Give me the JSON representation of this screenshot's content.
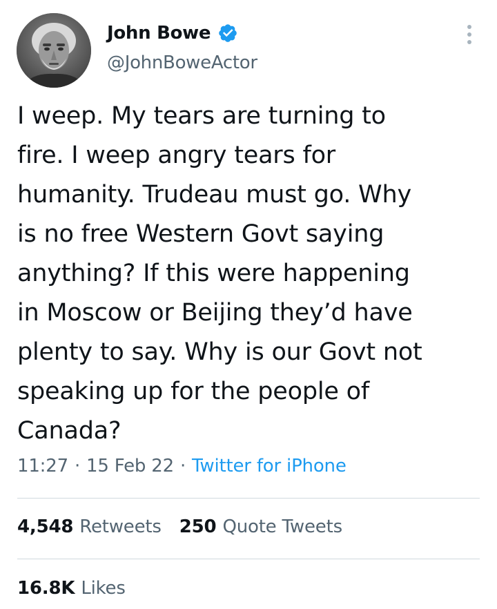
{
  "author": {
    "display_name": "John Bowe",
    "handle": "@JohnBoweActor",
    "avatar_icon": "portrait-photo",
    "verified_icon": "verified-badge-icon",
    "verified_color": "#1d9bf0"
  },
  "tweet": {
    "text": "I weep. My tears are turning to\nfire. I weep angry tears for\nhumanity. Trudeau must go. Why\nis no free Western Govt saying\nanything? If this were happening\nin Moscow or Beijing they’d have\nplenty to say. Why is our Govt not\nspeaking up for the people of\nCanada?",
    "time": "11:27",
    "separator": "·",
    "date": "15 Feb 22",
    "source": "Twitter for iPhone"
  },
  "stats": {
    "retweets_count": "4,548",
    "retweets_label": "Retweets",
    "quotes_count": "250",
    "quotes_label": "Quote Tweets",
    "likes_count": "16.8K",
    "likes_label": "Likes"
  },
  "colors": {
    "text": "#0f1419",
    "secondary": "#536471",
    "link": "#1d9bf0",
    "divider": "#cfd9de"
  }
}
